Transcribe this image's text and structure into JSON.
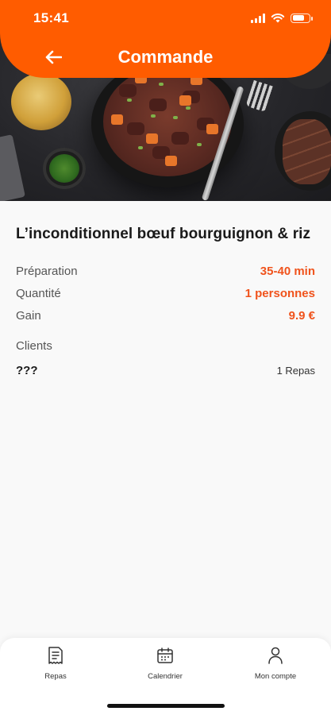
{
  "status_bar": {
    "time": "15:41"
  },
  "header": {
    "title": "Commande",
    "back_icon": "arrow-left-icon"
  },
  "dish": {
    "name": "L’inconditionnel bœuf bourguignon & riz"
  },
  "details": [
    {
      "label": "Préparation",
      "value": "35-40 min"
    },
    {
      "label": "Quantité",
      "value": "1 personnes"
    },
    {
      "label": "Gain",
      "value": "9.9 €"
    }
  ],
  "clients": {
    "title": "Clients",
    "items": [
      {
        "name": "???",
        "count": "1 Repas"
      }
    ]
  },
  "bottom_nav": {
    "items": [
      {
        "label": "Repas",
        "icon": "receipt-icon"
      },
      {
        "label": "Calendrier",
        "icon": "calendar-icon"
      },
      {
        "label": "Mon compte",
        "icon": "user-icon"
      }
    ]
  },
  "colors": {
    "accent": "#ff5c00",
    "value_text": "#f0531c"
  }
}
